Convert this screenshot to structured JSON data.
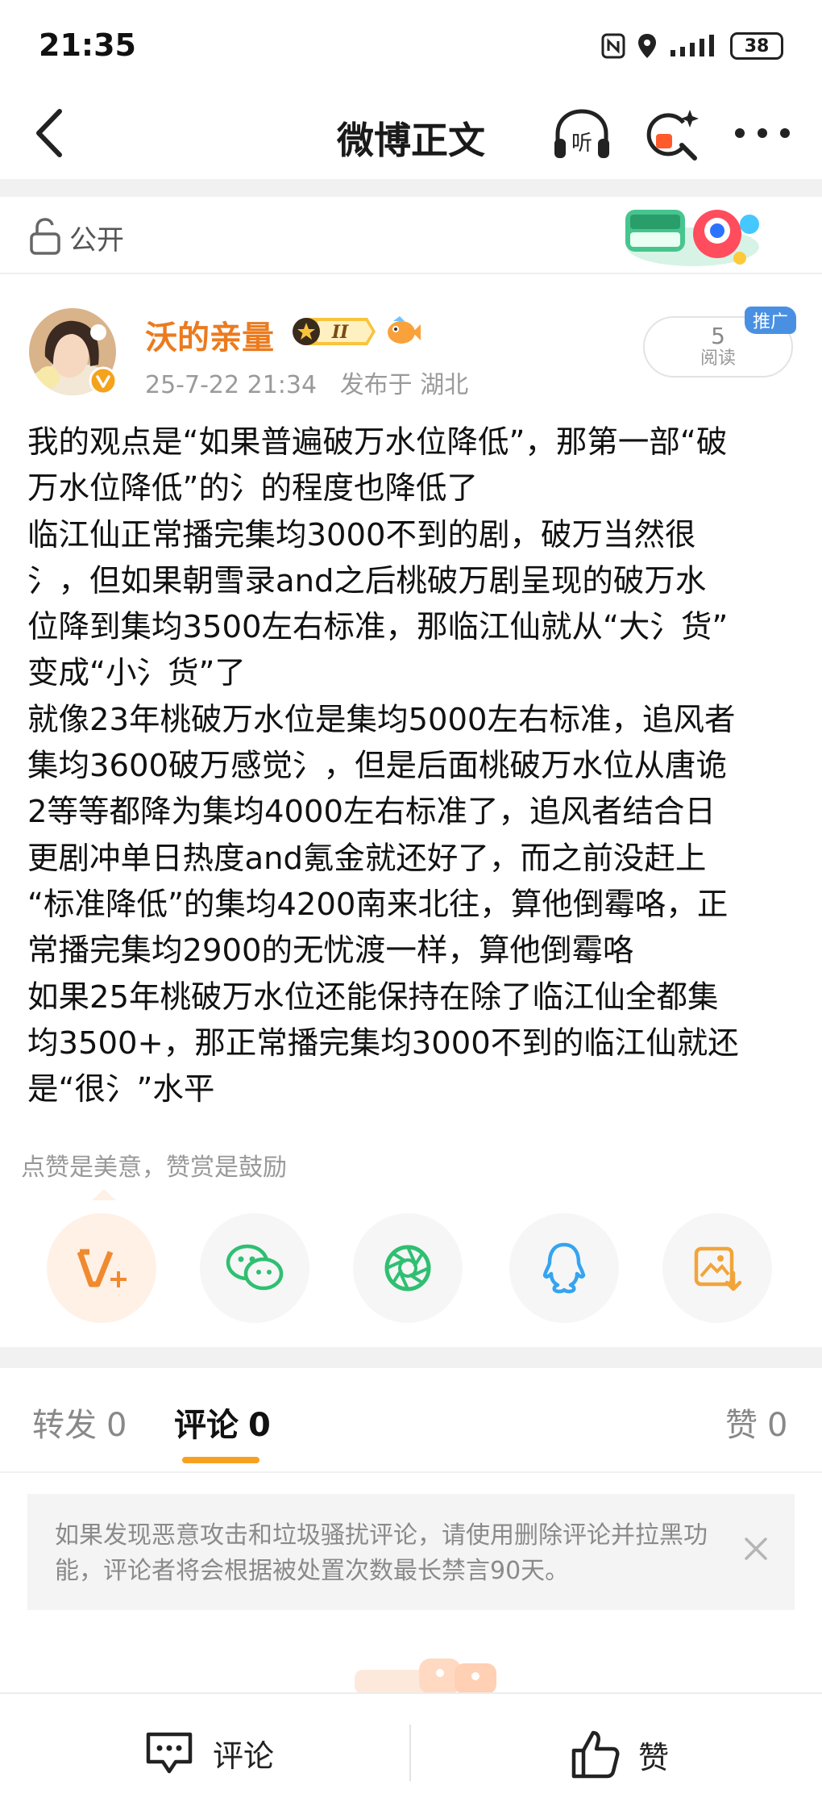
{
  "status_bar": {
    "time": "21:35",
    "battery": "38"
  },
  "header": {
    "title": "微博正文"
  },
  "visibility": {
    "label": "公开"
  },
  "author": {
    "name": "沃的亲量",
    "level": "II",
    "time": "25-7-22 21:34",
    "location": "发布于 湖北"
  },
  "stats": {
    "reads": "5",
    "reads_label": "阅读",
    "promo_tag": "推广"
  },
  "post": {
    "lines": [
      "我的观点是“如果普遍破万水位降低”，那第一部“破",
      "万水位降低”的氵的程度也降低了",
      "临江仙正常播完集均3000不到的剧，破万当然很",
      "氵，但如果朝雪录and之后桃破万剧呈现的破万水",
      "位降到集均3500左右标准，那临江仙就从“大氵货”",
      "变成“小氵货”了",
      "就像23年桃破万水位是集均5000左右标准，追风者",
      "集均3600破万感觉氵，但是后面桃破万水位从唐诡",
      "2等等都降为集均4000左右标准了，追风者结合日",
      "更剧冲单日热度and氪金就还好了，而之前没赶上",
      "“标准降低”的集均4200南来北往，算他倒霉咯，正",
      "常播完集均2900的无忧渡一样，算他倒霉咯",
      "如果25年桃破万水位还能保持在除了临江仙全都集",
      "均3500+，那正常播完集均3000不到的临江仙就还",
      "是“很氵”水平"
    ]
  },
  "reward": {
    "tip": "点赞是美意，赞赏是鼓励"
  },
  "tabs": {
    "repost_label": "转发",
    "repost_count": "0",
    "comment_label": "评论",
    "comment_count": "0",
    "like_label": "赞",
    "like_count": "0"
  },
  "notice": {
    "text": "如果发现恶意攻击和垃圾骚扰评论，请使用删除评论并拉黑功能，评论者将会根据被处置次数最长禁言90天。"
  },
  "bottom_bar": {
    "comment_label": "评论",
    "like_label": "赞"
  },
  "colors": {
    "accent_orange": "#eb7b1f",
    "tab_underline": "#f7a120",
    "wechat_green": "#2fbf71",
    "qq_blue": "#35a4f0",
    "promo_blue": "#4a90e2"
  },
  "icons": [
    "back-icon",
    "listen-icon",
    "search-ai-icon",
    "more-icon",
    "lock-icon",
    "reward-icon",
    "wechat-icon",
    "moments-icon",
    "qq-icon",
    "save-image-icon",
    "close-icon",
    "comment-icon",
    "thumbs-up-icon"
  ]
}
